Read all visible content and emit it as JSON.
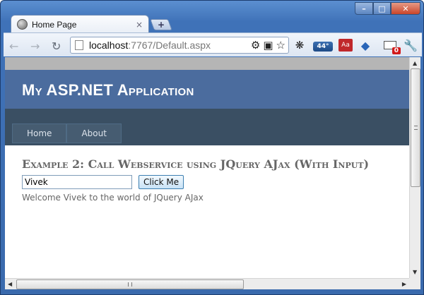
{
  "browser": {
    "tab_title": "Home Page",
    "tab_close": "×",
    "new_tab": "+",
    "url_host": "localhost",
    "url_rest": ":7767/Default.aspx",
    "weather_badge": "44°",
    "dict_badge": "Aa",
    "notification_count": "0",
    "window_controls": {
      "minimize": "–",
      "maximize": "□",
      "close": "✕"
    }
  },
  "site": {
    "app_title": "My ASP.NET Application",
    "menu": [
      "Home",
      "About"
    ]
  },
  "main": {
    "heading": "Example 2: Call Webservice using JQuery AJax (With Input)",
    "input_value": "Vivek",
    "button_label": "Click Me",
    "welcome_text": "Welcome Vivek to the world of JQuery AJax"
  },
  "colors": {
    "header_bg": "#4b6c9e",
    "menubar_bg": "#3a4f63",
    "menu_item_bg": "#465c71"
  }
}
